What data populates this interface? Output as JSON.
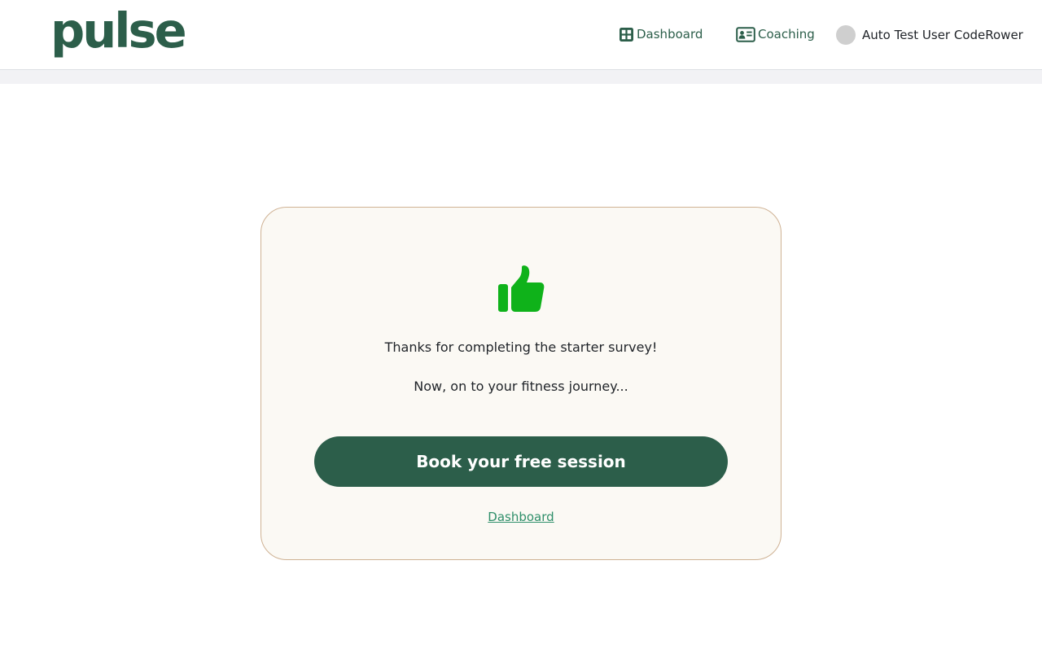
{
  "app": {
    "logo_text": "pulse",
    "brand_color": "#2c5e4a"
  },
  "nav": {
    "items": [
      {
        "label": "Dashboard",
        "icon": "grid-icon"
      },
      {
        "label": "Coaching",
        "icon": "id-card-icon"
      }
    ],
    "user": {
      "name": "Auto Test User CodeRower",
      "avatar_icon": "avatar"
    }
  },
  "card": {
    "icon": "thumbs-up-icon",
    "icon_color": "#0fb21a",
    "message_primary": "Thanks for completing the starter survey!",
    "message_secondary": "Now, on to your fitness journey...",
    "cta_label": "Book your free session",
    "secondary_link_label": "Dashboard"
  }
}
